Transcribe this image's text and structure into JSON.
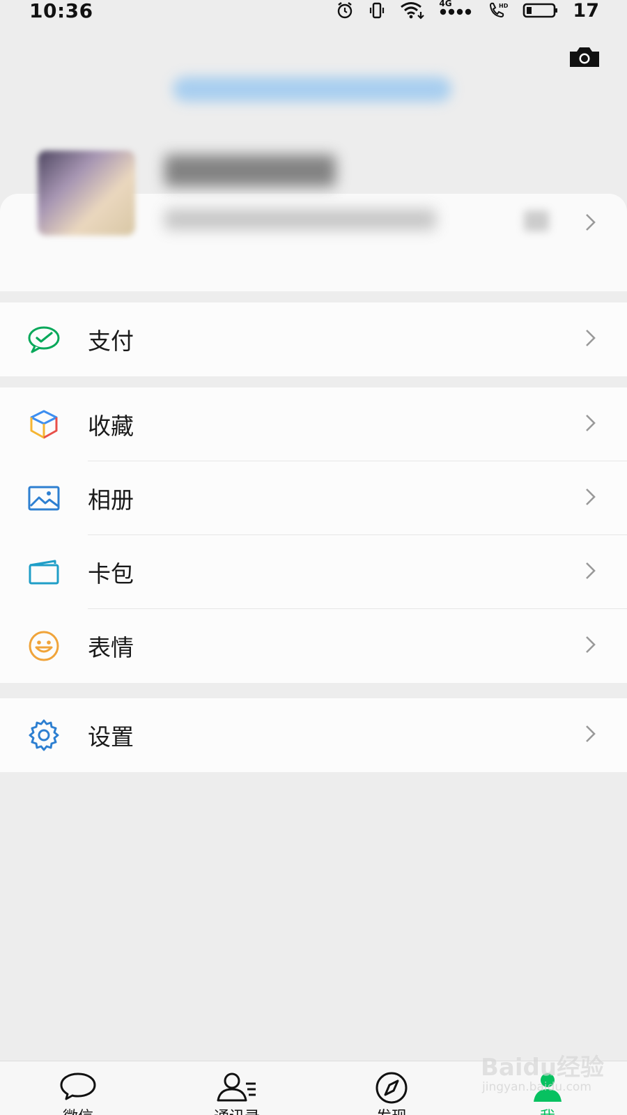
{
  "status_bar": {
    "time": "10:36",
    "network_label": "4G",
    "battery_level": "17"
  },
  "menu": {
    "pay": {
      "label": "支付",
      "icon": "wechat-pay-icon"
    },
    "favorites": {
      "label": "收藏",
      "icon": "favorites-cube-icon"
    },
    "album": {
      "label": "相册",
      "icon": "album-icon"
    },
    "cards": {
      "label": "卡包",
      "icon": "card-wallet-icon"
    },
    "stickers": {
      "label": "表情",
      "icon": "smiley-icon"
    },
    "settings": {
      "label": "设置",
      "icon": "gear-icon"
    }
  },
  "tab_bar": {
    "tabs": [
      {
        "label": "微信",
        "icon": "chat-bubble-icon",
        "active": false
      },
      {
        "label": "通讯录",
        "icon": "contacts-icon",
        "active": false
      },
      {
        "label": "发现",
        "icon": "compass-icon",
        "active": false
      },
      {
        "label": "我",
        "icon": "me-icon",
        "active": true
      }
    ]
  },
  "watermark": {
    "main": "Baidu经验",
    "sub": "jingyan.baidu.com"
  },
  "colors": {
    "accent_green": "#07c160",
    "page_background": "#ededed",
    "card_background": "#fcfcfc"
  }
}
